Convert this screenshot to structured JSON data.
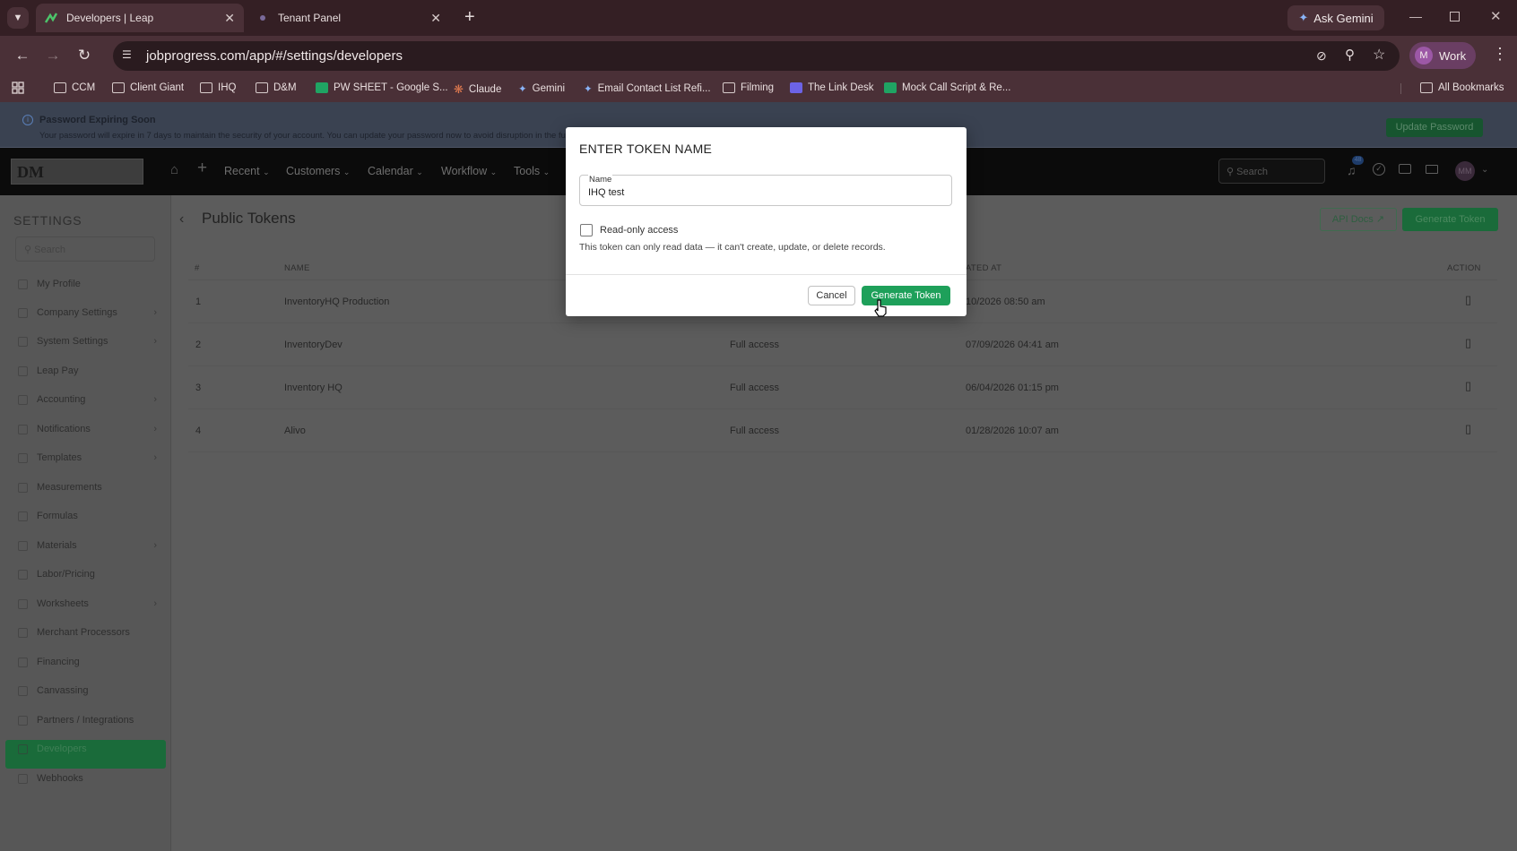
{
  "browser": {
    "tabs": [
      {
        "label": "Developers | Leap",
        "active": true
      },
      {
        "label": "Tenant Panel",
        "active": false
      }
    ],
    "ask_gemini": "Ask Gemini",
    "url": "jobprogress.com/app/#/settings/developers",
    "profile": {
      "initial": "M",
      "label": "Work"
    },
    "bookmarks": [
      "CCM",
      "Client Giant",
      "IHQ",
      "D&M",
      "PW SHEET - Google S...",
      "Claude",
      "Gemini",
      "Email Contact List Refi...",
      "Filming",
      "The Link Desk",
      "Mock Call Script & Re..."
    ],
    "all_bookmarks": "All Bookmarks"
  },
  "banner": {
    "title": "Password Expiring Soon",
    "text": "Your password will expire in 7 days to maintain the security of your account. You can update your password now to avoid disruption in the fu",
    "button": "Update Password"
  },
  "appnav": {
    "items": [
      "Recent",
      "Customers",
      "Calendar",
      "Workflow",
      "Tools"
    ],
    "search_placeholder": "Search",
    "notif_count": "48",
    "avatar": "MM"
  },
  "sidebar": {
    "title": "SETTINGS",
    "search_placeholder": "Search",
    "items": [
      {
        "label": "My Profile",
        "chevron": false
      },
      {
        "label": "Company Settings",
        "chevron": true
      },
      {
        "label": "System Settings",
        "chevron": true
      },
      {
        "label": "Leap Pay",
        "chevron": false
      },
      {
        "label": "Accounting",
        "chevron": true
      },
      {
        "label": "Notifications",
        "chevron": true
      },
      {
        "label": "Templates",
        "chevron": true
      },
      {
        "label": "Measurements",
        "chevron": false
      },
      {
        "label": "Formulas",
        "chevron": false
      },
      {
        "label": "Materials",
        "chevron": true
      },
      {
        "label": "Labor/Pricing",
        "chevron": false
      },
      {
        "label": "Worksheets",
        "chevron": true
      },
      {
        "label": "Merchant Processors",
        "chevron": false
      },
      {
        "label": "Financing",
        "chevron": false
      },
      {
        "label": "Canvassing",
        "chevron": false
      },
      {
        "label": "Partners / Integrations",
        "chevron": false
      },
      {
        "label": "Developers",
        "chevron": false,
        "active": true
      },
      {
        "label": "Webhooks",
        "chevron": false
      }
    ]
  },
  "main": {
    "title": "Public Tokens",
    "api_docs": "API Docs",
    "generate_token": "Generate Token",
    "headers": {
      "num": "#",
      "name": "NAME",
      "created": "ATED AT",
      "action": "ACTION"
    },
    "rows": [
      {
        "num": "1",
        "name": "InventoryHQ Production",
        "access": "",
        "created": "10/2026 08:50 am"
      },
      {
        "num": "2",
        "name": "InventoryDev",
        "access": "Full access",
        "created": "07/09/2026 04:41 am"
      },
      {
        "num": "3",
        "name": "Inventory HQ",
        "access": "Full access",
        "created": "06/04/2026 01:15 pm"
      },
      {
        "num": "4",
        "name": "Alivo",
        "access": "Full access",
        "created": "01/28/2026 10:07 am"
      }
    ]
  },
  "modal": {
    "title": "ENTER TOKEN NAME",
    "field_label": "Name",
    "field_value": "IHQ test",
    "checkbox_label": "Read-only access",
    "checkbox_checked": false,
    "help": "This token can only read data — it can't create, update, or delete records.",
    "cancel": "Cancel",
    "submit": "Generate Token"
  },
  "colors": {
    "accent_green": "#1ea05a",
    "sidebar_active": "#1a6b3a",
    "tabbar": "#341f24"
  }
}
